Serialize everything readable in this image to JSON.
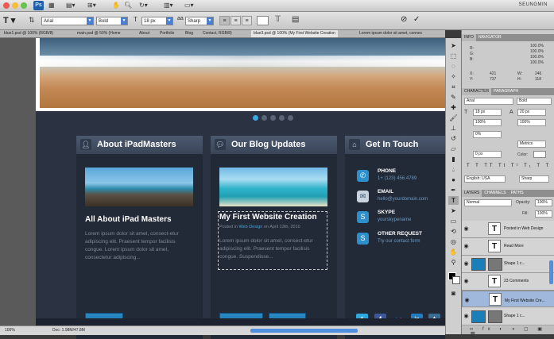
{
  "menubar": {
    "ps_logo": "Ps",
    "user": "SEUNGMIN"
  },
  "options": {
    "font_family": "Arial",
    "font_style": "Bold",
    "font_size": "18 px",
    "antialias": "Sharp"
  },
  "tabs": [
    "blue1.psd @ 100% (RGB/8)",
    "main.psd @ 50% (Home",
    "About",
    "Portfolio",
    "Blog",
    "Contact, RGB/8)",
    "blue3.psd @ 100% (My First Website Creation",
    "Lorem ipsum dolor sit amet, connec"
  ],
  "site": {
    "about": {
      "heading": "About iPadMasters",
      "title": "All About iPad Masters",
      "body": "Lorem ipsum dolor sit amet, consect-etur adipiscing elit. Praesent tempor facilisis congue. Lorem ipsum dolor sit amet, consectetur adipiscing...",
      "button": "Learn More"
    },
    "blog": {
      "heading": "Our Blog Updates",
      "title": "My First Website Creation",
      "meta_prefix": "Posted in",
      "meta_category": "Web Design",
      "meta_suffix": "on April 13th, 2010",
      "body": "Lorem ipsum dolor sit amet, consect-etur adipiscing elit. Praesent tempor facilisis congue. Suspendisse...",
      "comments_button": "23 Comments",
      "read_button": "Read More"
    },
    "contact": {
      "heading": "Get In Touch",
      "items": [
        {
          "label": "PHONE",
          "value": "1+ (123) 456.4789",
          "icon": "phone-icon"
        },
        {
          "label": "EMAIL",
          "value": "hello@yourdomain.com",
          "icon": "mail-icon"
        },
        {
          "label": "SKYPE",
          "value": "yourskypename",
          "icon": "skype-icon"
        },
        {
          "label": "OTHER REQUEST",
          "value": "Try our contact form",
          "icon": "skype-icon"
        }
      ],
      "social": [
        "twitter",
        "facebook",
        "flickr",
        "linkedin",
        "tumblr"
      ]
    }
  },
  "status": {
    "zoom": "100%",
    "doc": "Doc: 1.98M/47.8M"
  },
  "panels": {
    "info_tabs": [
      "INFO",
      "NAVIGATOR"
    ],
    "info": {
      "r": "R:",
      "g": "G:",
      "b": "B:",
      "c_val": "100.0%",
      "m_val": "100.0%",
      "y_val": "100.0%",
      "k_val": "100.0%",
      "x_lbl": "X:",
      "y_lbl": "Y:",
      "x_val": "421",
      "y_val2": "737",
      "w_lbl": "W:",
      "h_lbl": "H:",
      "w_val": "246",
      "h_val": "118"
    },
    "char_tabs": [
      "CHARACTER",
      "PARAGRAPH"
    ],
    "character": {
      "font_family": "Arial",
      "font_style": "Bold",
      "size": "18 px",
      "leading": "20 px",
      "tracking": "100%",
      "vscale": "100%",
      "kern": "0%",
      "metrics": "Metrics",
      "baseline": "0 px",
      "color_label": "Color:",
      "language": "English: USA",
      "aa": "Sharp"
    },
    "layers_tabs": [
      "LAYERS",
      "CHANNELS",
      "PATHS"
    ],
    "layers": {
      "blend": "Normal",
      "opacity_label": "Opacity:",
      "opacity": "100%",
      "fill_label": "Fill:",
      "fill": "100%",
      "items": [
        {
          "name": "Posted in Web Design",
          "kind": "T",
          "selected": false
        },
        {
          "name": "Read More",
          "kind": "T",
          "selected": false
        },
        {
          "name": "Shape 1 c...",
          "kind": "S",
          "selected": false
        },
        {
          "name": "23 Comments",
          "kind": "T",
          "selected": false
        },
        {
          "name": "My First Website Cre...",
          "kind": "T",
          "selected": true
        },
        {
          "name": "Shape 1 c...",
          "kind": "S",
          "selected": false
        }
      ]
    }
  },
  "colors": {
    "accent": "#2e8fcd",
    "site_bg": "#2b3342",
    "twitter": "#2fa8e0",
    "facebook": "#3b5998",
    "flickr": "#1f2a3a",
    "linkedin": "#1f7cc0",
    "tumblr": "#3a6b93"
  }
}
